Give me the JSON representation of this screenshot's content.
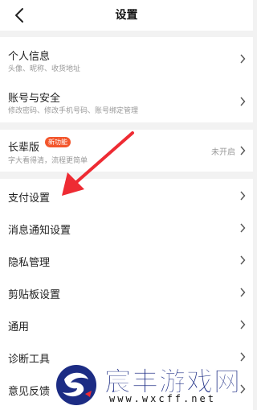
{
  "header": {
    "title": "设置"
  },
  "groups": {
    "account": {
      "profile": {
        "label": "个人信息",
        "sub": "头像、昵称、收货地址"
      },
      "security": {
        "label": "账号与安全",
        "sub": "修改密码、修改手机号码、账号绑定管理"
      }
    },
    "elder": {
      "label": "长辈版",
      "badge": "新功能",
      "sub": "字大看得清，流程更简单",
      "status": "未开启"
    },
    "items": [
      {
        "label": "支付设置"
      },
      {
        "label": "消息通知设置"
      },
      {
        "label": "隐私管理"
      },
      {
        "label": "剪贴板设置"
      },
      {
        "label": "通用"
      },
      {
        "label": "诊断工具"
      },
      {
        "label": "意见反馈"
      }
    ]
  },
  "watermark": {
    "brand": "宸丰游戏网",
    "url": "www.wxcff.net"
  },
  "colors": {
    "badge": "#f3562c",
    "arrow": "#ee2b33",
    "watermark": "#1c2c84"
  }
}
